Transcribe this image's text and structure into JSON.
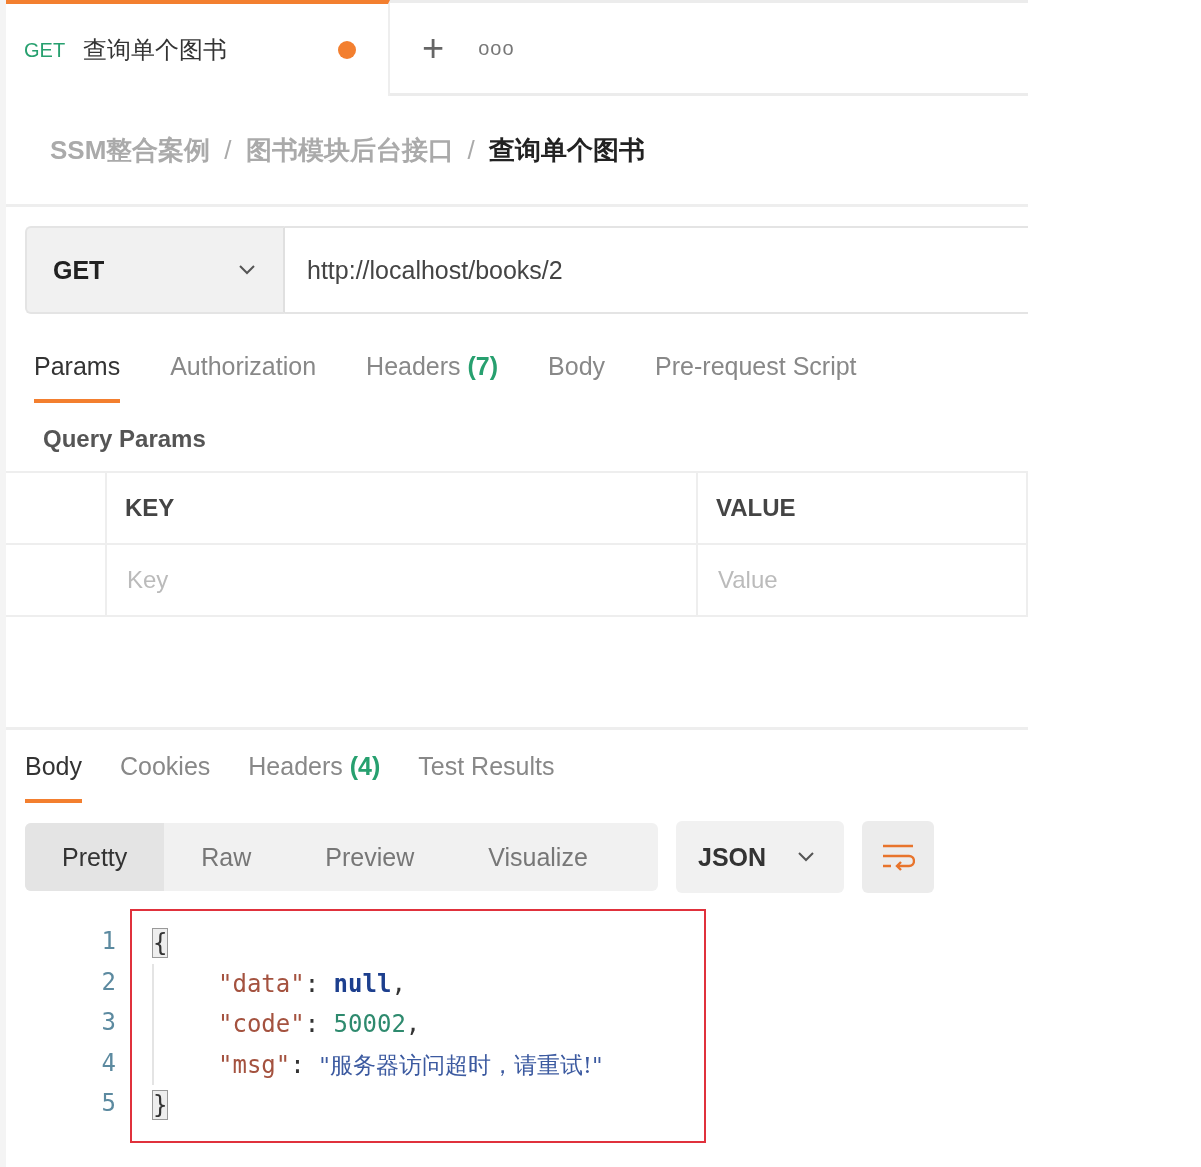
{
  "tabs": [
    {
      "method": "GET",
      "title": "查询单个图书",
      "unsaved": true,
      "selected": true
    }
  ],
  "tab_actions": {
    "add": "+",
    "more": "ooo"
  },
  "breadcrumb": [
    {
      "label": "SSM整合案例",
      "current": false
    },
    {
      "label": "图书模块后台接口",
      "current": false
    },
    {
      "label": "查询单个图书",
      "current": true
    }
  ],
  "breadcrumb_separator": "/",
  "request": {
    "method": "GET",
    "url": "http://localhost/books/2"
  },
  "request_tabs": [
    {
      "label": "Params",
      "selected": true
    },
    {
      "label": "Authorization",
      "selected": false
    },
    {
      "label": "Headers",
      "count": "(7)",
      "selected": false
    },
    {
      "label": "Body",
      "selected": false
    },
    {
      "label": "Pre-request Script",
      "selected": false
    }
  ],
  "query_params": {
    "title": "Query Params",
    "columns": [
      "KEY",
      "VALUE"
    ],
    "placeholders": [
      "Key",
      "Value"
    ]
  },
  "response_tabs": [
    {
      "label": "Body",
      "selected": true
    },
    {
      "label": "Cookies",
      "selected": false
    },
    {
      "label": "Headers",
      "count": "(4)",
      "selected": false
    },
    {
      "label": "Test Results",
      "selected": false
    }
  ],
  "view_modes": [
    {
      "label": "Pretty",
      "selected": true
    },
    {
      "label": "Raw",
      "selected": false
    },
    {
      "label": "Preview",
      "selected": false
    },
    {
      "label": "Visualize",
      "selected": false
    }
  ],
  "format": "JSON",
  "code_lines": [
    {
      "number": "1",
      "indent": false,
      "tokens": [
        {
          "kind": "brace",
          "text": "{"
        }
      ]
    },
    {
      "number": "2",
      "indent": true,
      "tokens": [
        {
          "kind": "key",
          "text": "\"data\""
        },
        {
          "kind": "punct",
          "text": ": "
        },
        {
          "kind": "keyword",
          "text": "null"
        },
        {
          "kind": "punct",
          "text": ","
        }
      ]
    },
    {
      "number": "3",
      "indent": true,
      "tokens": [
        {
          "kind": "key",
          "text": "\"code\""
        },
        {
          "kind": "punct",
          "text": ": "
        },
        {
          "kind": "number",
          "text": "50002"
        },
        {
          "kind": "punct",
          "text": ","
        }
      ]
    },
    {
      "number": "4",
      "indent": true,
      "tokens": [
        {
          "kind": "key",
          "text": "\"msg\""
        },
        {
          "kind": "punct",
          "text": ": "
        },
        {
          "kind": "string",
          "text": "\"服务器访问超时，请重试!\""
        }
      ]
    },
    {
      "number": "5",
      "indent": false,
      "tokens": [
        {
          "kind": "brace",
          "text": "}"
        }
      ]
    }
  ]
}
